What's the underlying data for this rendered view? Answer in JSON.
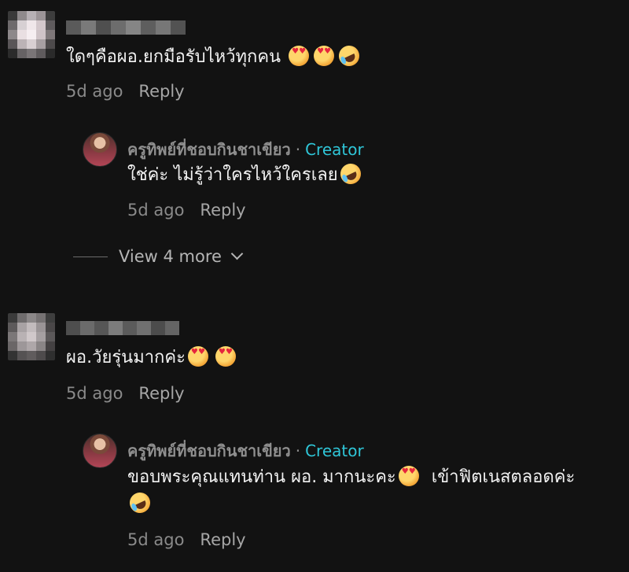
{
  "comments": [
    {
      "text": "ใดๆคือผอ.ยกมือรับไหว้ทุกคน",
      "emojis": [
        "smiling-face-with-hearts",
        "smiling-face-with-hearts",
        "rolling-on-floor-laughing"
      ],
      "time": "5d ago",
      "reply_label": "Reply",
      "reply": {
        "username": "ครูทิพย์ที่ชอบกินชาเขียว",
        "badge": "Creator",
        "separator": "·",
        "text": "ใช่ค่ะ ไม่รู้ว่าใครไหว้ใครเลย",
        "emojis": [
          "rolling-on-floor-laughing"
        ],
        "time": "5d ago",
        "reply_label": "Reply"
      },
      "view_more": "View 4 more"
    },
    {
      "text": "ผอ.วัยรุ่นมากค่ะ",
      "emojis": [
        "smiling-face-with-hearts",
        "smiling-face-with-hearts"
      ],
      "time": "5d ago",
      "reply_label": "Reply",
      "reply": {
        "username": "ครูทิพย์ที่ชอบกินชาเขียว",
        "badge": "Creator",
        "separator": "·",
        "text_part1": "ขอบพระคุณแทนท่าน ผอ. มากนะคะ",
        "text_part2": "เข้าฟิตเนสตลอดค่ะ",
        "emojis": [
          "smiling-face-with-hearts",
          "rolling-on-floor-laughing"
        ],
        "time": "5d ago",
        "reply_label": "Reply"
      }
    }
  ],
  "colors": {
    "background": "#121212",
    "creator_badge": "#2fc6d8",
    "meta_text": "#8a8a8a"
  }
}
